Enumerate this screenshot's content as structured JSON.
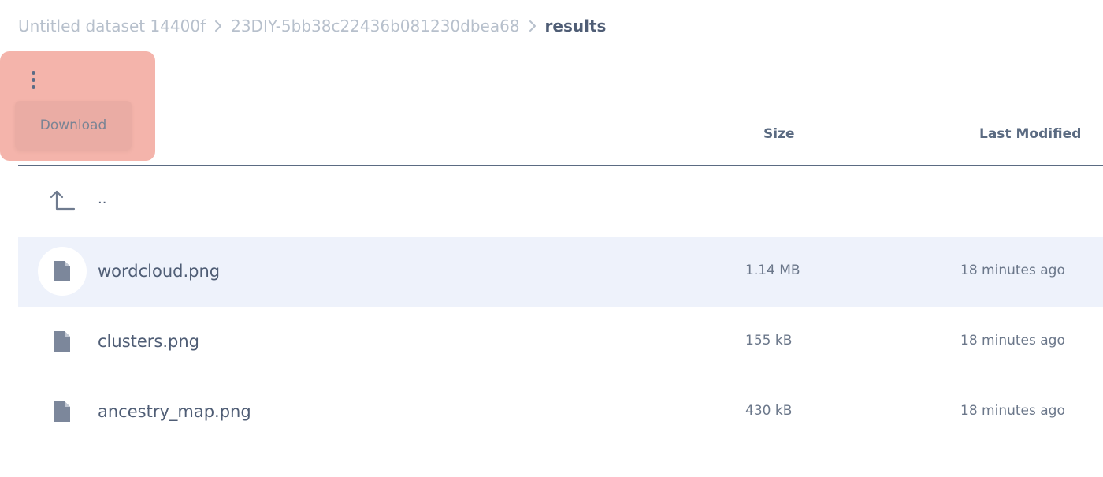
{
  "breadcrumb": {
    "items": [
      "Untitled dataset 14400f",
      "23DIY-5bb38c22436b081230dbea68"
    ],
    "current": "results"
  },
  "actions": {
    "menu_icon": "kebab-menu-icon",
    "download_label": "Download"
  },
  "table": {
    "columns": {
      "size": "Size",
      "last_modified": "Last Modified"
    },
    "parent": {
      "icon": "arrow-up-left-icon",
      "label": ".."
    },
    "rows": [
      {
        "name": "wordcloud.png",
        "size": "1.14 MB",
        "modified": "18 minutes ago",
        "icon": "file-icon",
        "selected": true
      },
      {
        "name": "clusters.png",
        "size": "155 kB",
        "modified": "18 minutes ago",
        "icon": "file-icon",
        "selected": false
      },
      {
        "name": "ancestry_map.png",
        "size": "430 kB",
        "modified": "18 minutes ago",
        "icon": "file-icon",
        "selected": false
      }
    ]
  },
  "colors": {
    "highlight": "#ec8273",
    "selected_row": "#eef2fb",
    "header_rule": "#5b6b82",
    "icon": "#7c879b"
  }
}
